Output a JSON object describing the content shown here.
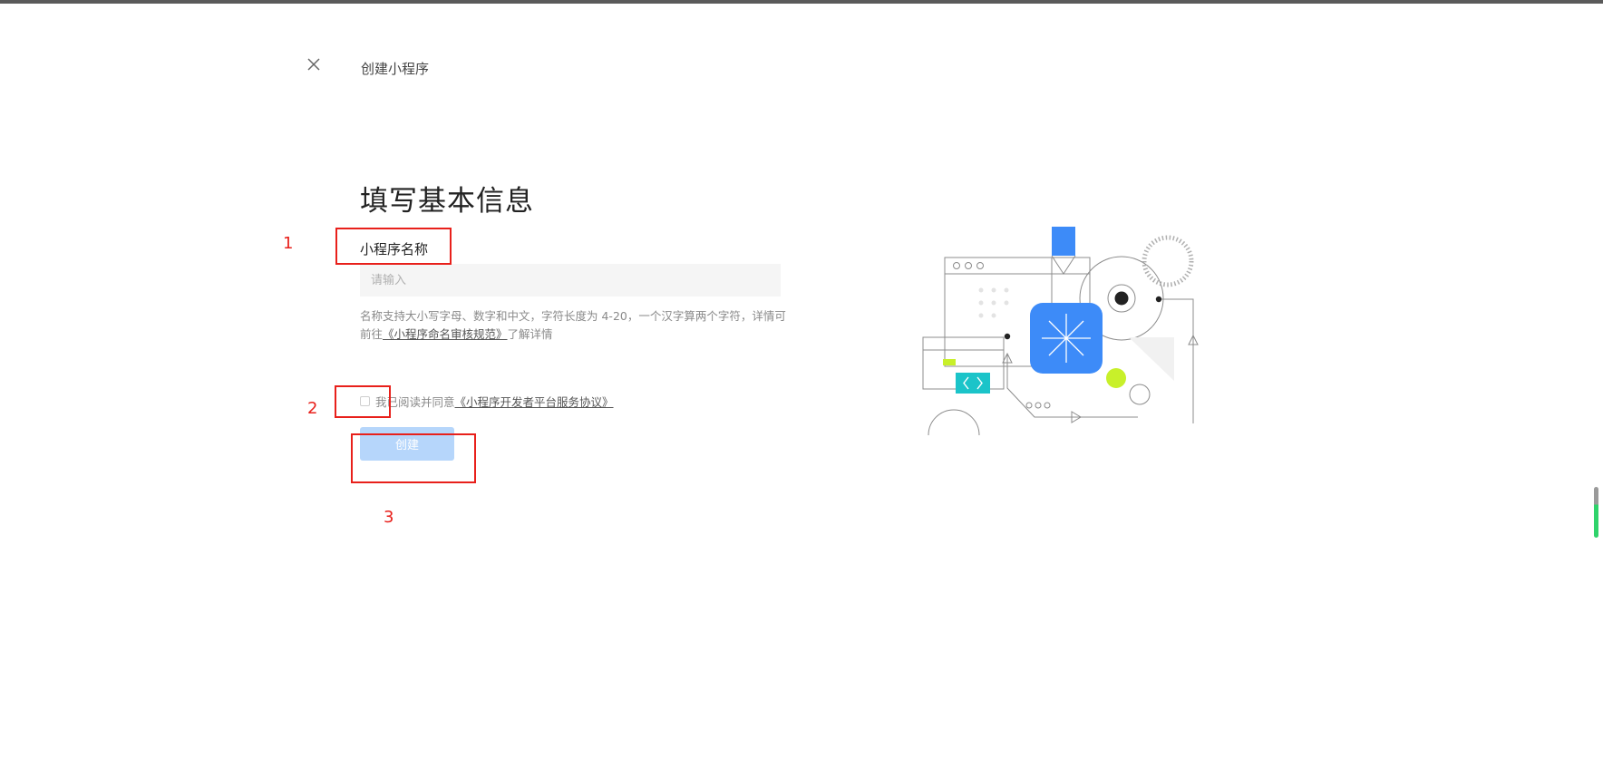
{
  "header": {
    "title": "创建小程序",
    "close_icon": "close-icon"
  },
  "form": {
    "title": "填写基本信息",
    "name_label": "小程序名称",
    "name_placeholder": "请输入",
    "name_value": "",
    "hint_prefix": "名称支持大小写字母、数字和中文，字符长度为 4-20，一个汉字算两个字符，详情可前往",
    "hint_link": "《小程序命名审核规范》",
    "hint_suffix": "了解详情",
    "agree_text": "我已阅读并同意",
    "agree_link": "《小程序开发者平台服务协议》",
    "agree_checked": false,
    "create_label": "创建",
    "create_enabled": false
  },
  "annotations": [
    {
      "label": "1"
    },
    {
      "label": "2"
    },
    {
      "label": "3"
    }
  ],
  "colors": {
    "primary_blue": "#3d8bf8",
    "button_disabled": "#b6d6fb",
    "annotation_red": "#e8201b",
    "accent_lime": "#c8f02a",
    "accent_teal": "#1bc4c9"
  }
}
